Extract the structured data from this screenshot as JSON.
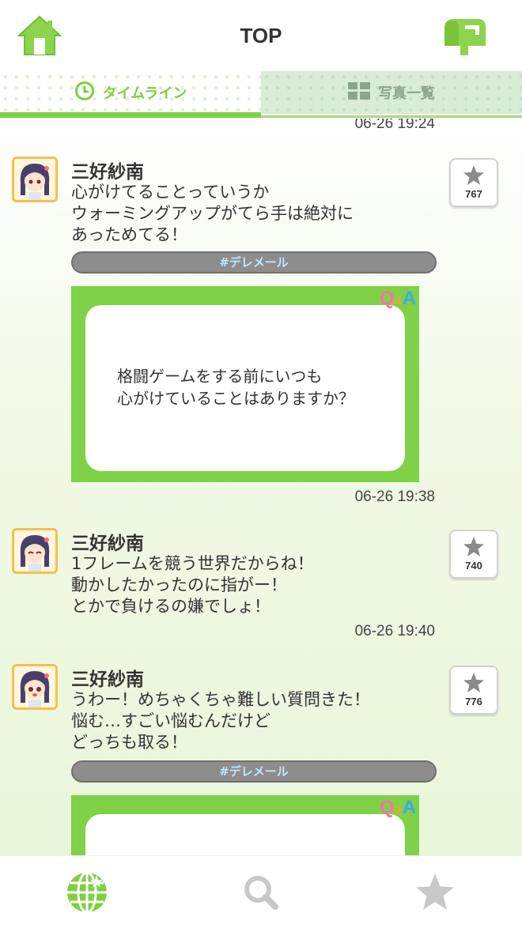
{
  "header": {
    "title": "TOP",
    "home_icon": "home-icon",
    "mail_icon": "mailbox-icon",
    "accent": "#7fd148"
  },
  "tabs": [
    {
      "label": "タイムライン",
      "icon": "clock-icon",
      "active": true
    },
    {
      "label": "写真一覧",
      "icon": "grid-icon",
      "active": false
    }
  ],
  "feed": {
    "top_timestamp": "06-26 19:24",
    "posts": [
      {
        "name": "三好紗南",
        "message": "心がけてることっていうか\nウォーミングアップがてら手は絶対に\nあっためてる！",
        "stars": "767",
        "tag": "#デレメール",
        "qa_badge": "Q&A",
        "qa_question": "格闘ゲームをする前にいつも\n心がけていることはありますか？",
        "timestamp": "06-26 19:38"
      },
      {
        "name": "三好紗南",
        "message": "1フレームを競う世界だからね！\n動かしたかったのに指がー！\nとかで負けるの嫌でしょ！",
        "stars": "740",
        "timestamp": "06-26 19:40"
      },
      {
        "name": "三好紗南",
        "message": "うわー！めちゃくちゃ難しい質問きた！\n悩む…すごい悩むんだけど\nどっちも取る！",
        "stars": "776",
        "tag": "#デレメール",
        "qa_badge": "Q&A"
      }
    ]
  },
  "bottom_nav": [
    {
      "icon": "globe-icon",
      "active": true
    },
    {
      "icon": "search-icon",
      "active": false
    },
    {
      "icon": "star-icon",
      "active": false
    }
  ]
}
